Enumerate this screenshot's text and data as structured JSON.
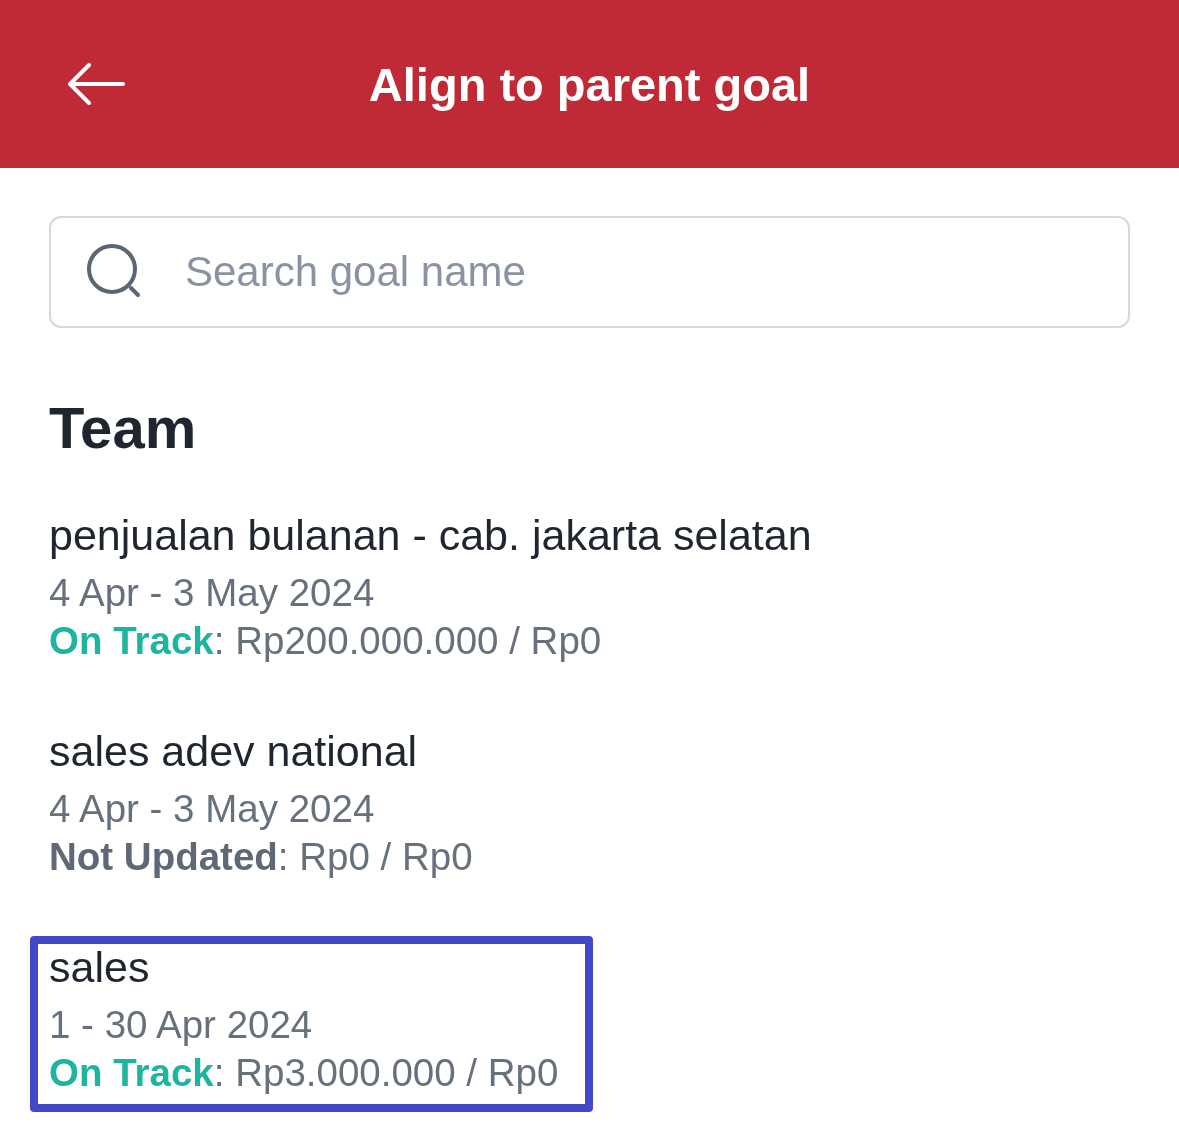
{
  "header": {
    "title": "Align to parent goal"
  },
  "search": {
    "placeholder": "Search goal name"
  },
  "section": {
    "title": "Team"
  },
  "goals": [
    {
      "name": "penjualan bulanan - cab. jakarta selatan",
      "period": "4 Apr - 3 May 2024",
      "status": {
        "label": "On Track",
        "color": "#1db5a0"
      },
      "progress": ": Rp200.000.000 / Rp0",
      "selected": false
    },
    {
      "name": "sales adev national",
      "period": "4 Apr - 3 May 2024",
      "status": {
        "label": "Not Updated",
        "color": "#5e6876"
      },
      "progress": ": Rp0 / Rp0",
      "selected": false
    },
    {
      "name": "sales",
      "period": "1 - 30 Apr 2024",
      "status": {
        "label": "On Track",
        "color": "#1db5a0"
      },
      "progress": ": Rp3.000.000 / Rp0",
      "selected": true
    }
  ]
}
